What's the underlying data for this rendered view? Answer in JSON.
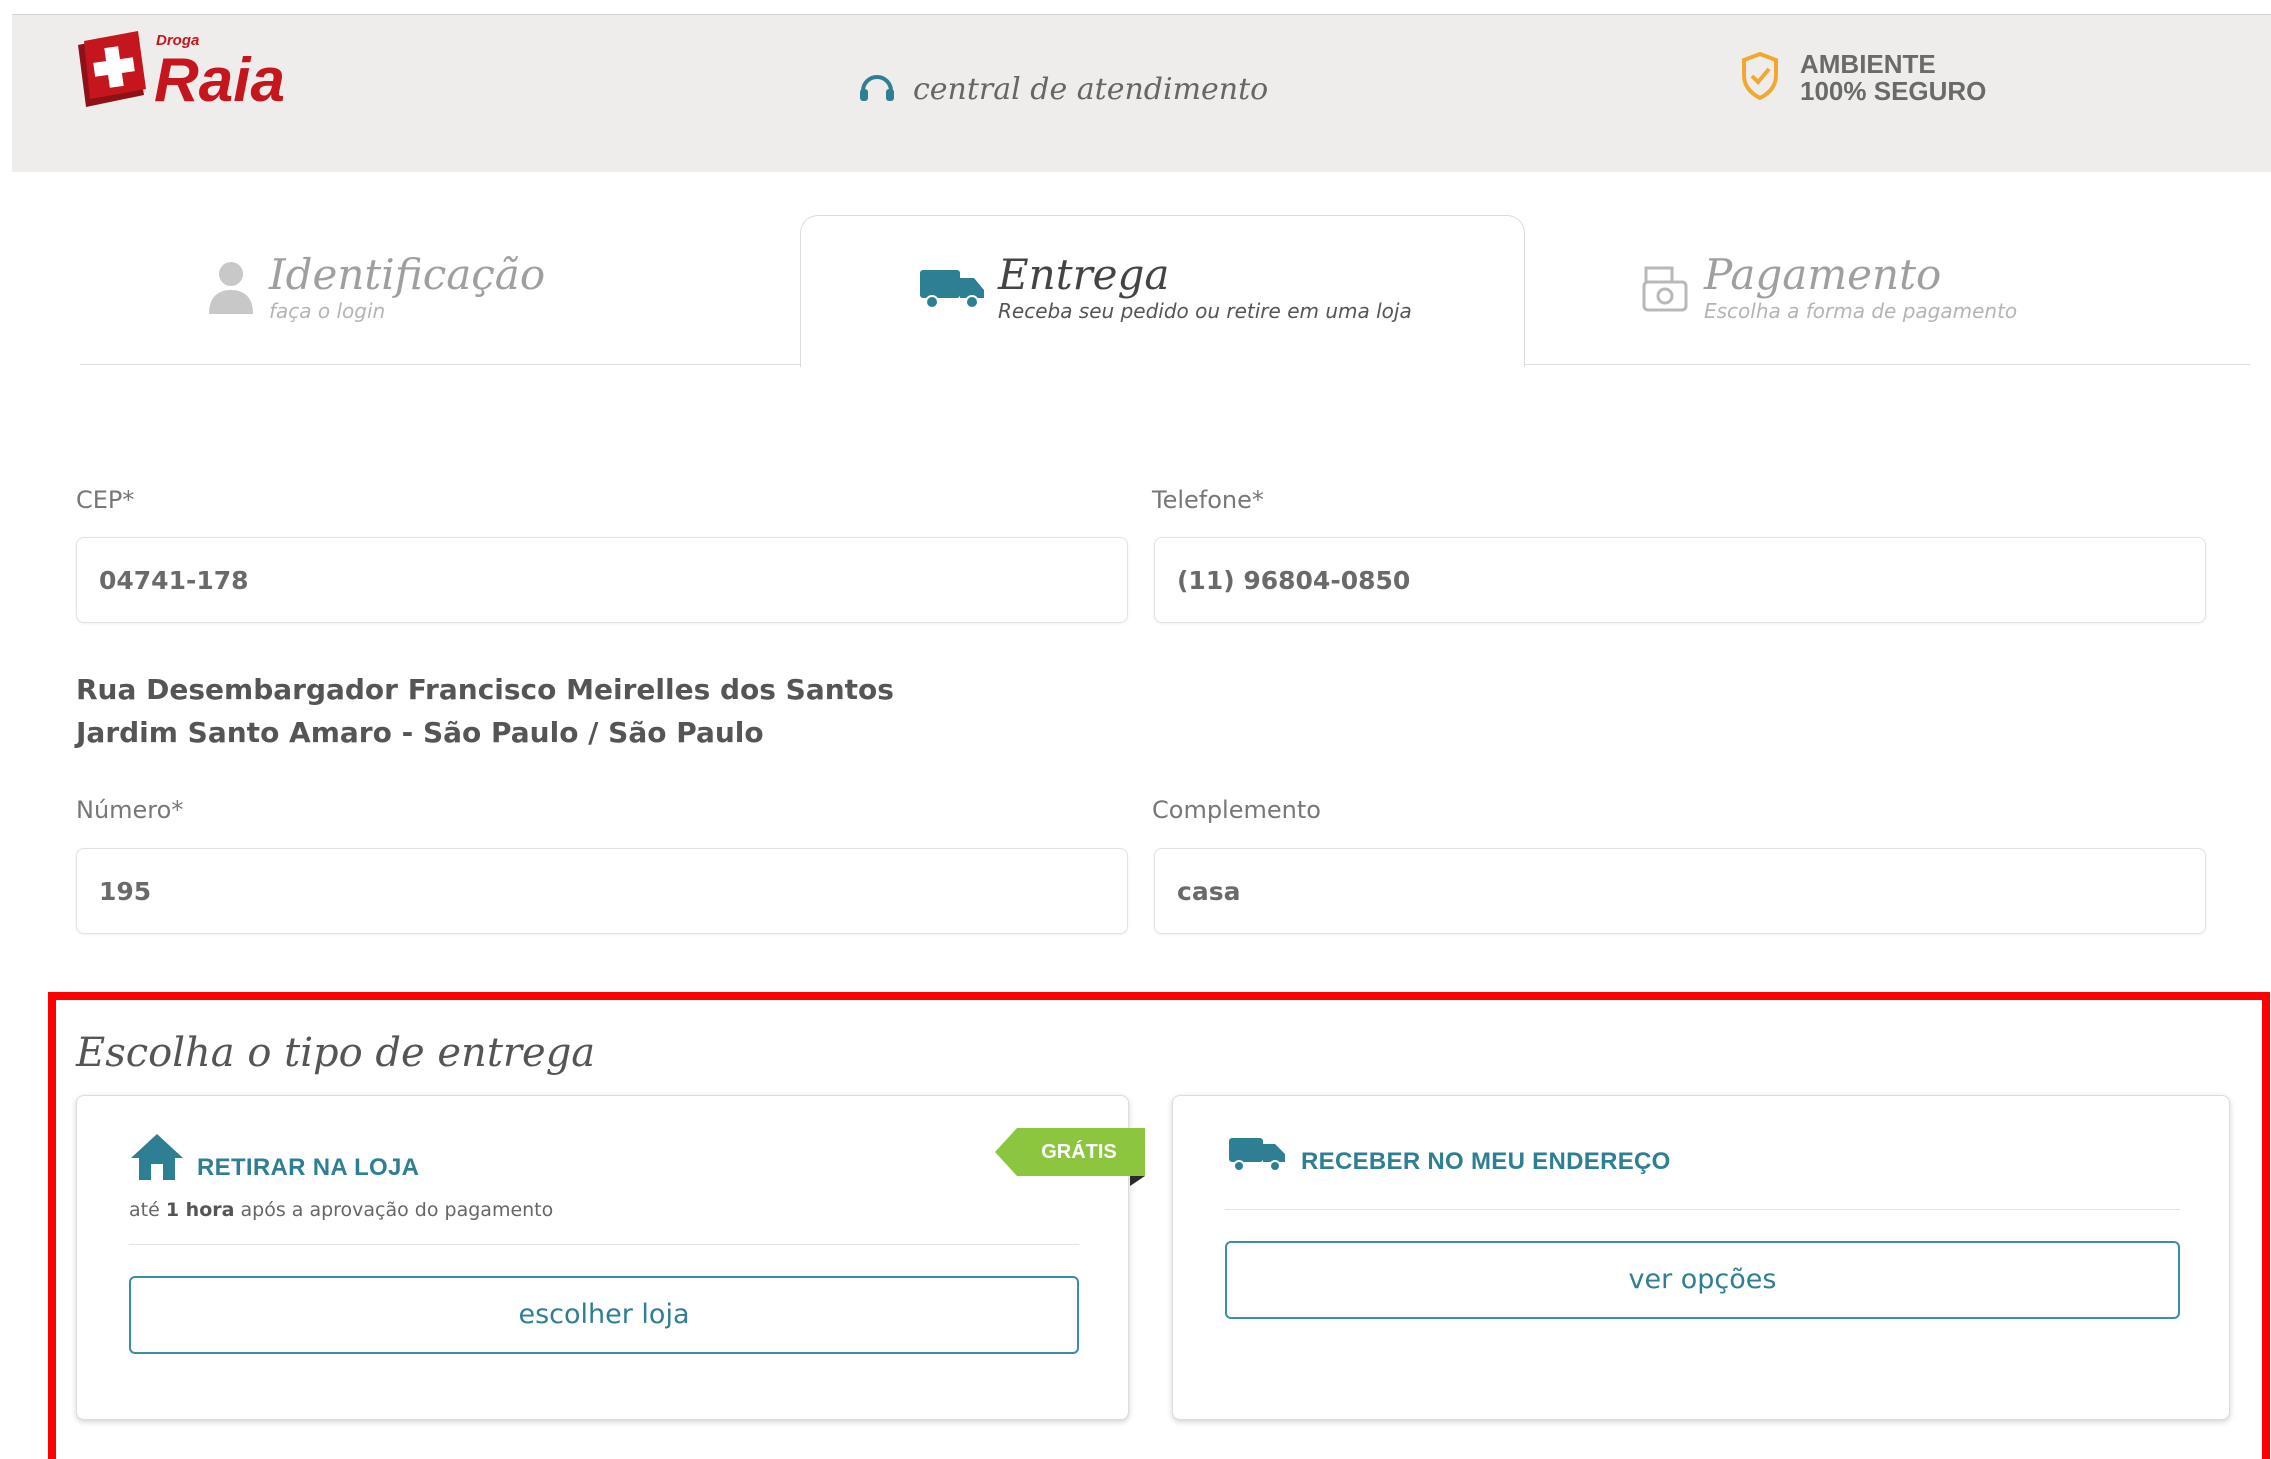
{
  "header": {
    "logo_small": "Droga",
    "logo_big": "Raia",
    "support_text": "central de atendimento",
    "secure_line1": "AMBIENTE",
    "secure_line2": "100% SEGURO"
  },
  "steps": [
    {
      "title": "Identificação",
      "subtitle": "faça o login",
      "state": "inactive"
    },
    {
      "title": "Entrega",
      "subtitle": "Receba seu pedido ou retire em uma loja",
      "state": "active"
    },
    {
      "title": "Pagamento",
      "subtitle": "Escolha a forma de pagamento",
      "state": "inactive"
    }
  ],
  "form": {
    "cep_label": "CEP*",
    "cep_value": "04741-178",
    "phone_label": "Telefone*",
    "phone_value": "(11) 96804-0850",
    "address_line1": "Rua Desembargador Francisco Meirelles dos Santos",
    "address_line2": "Jardim Santo Amaro - São Paulo / São Paulo",
    "number_label": "Número*",
    "number_value": "195",
    "complement_label": "Complemento",
    "complement_value": "casa"
  },
  "delivery": {
    "title": "Escolha o tipo de entrega",
    "pickup": {
      "title": "RETIRAR NA LOJA",
      "sub_prefix": "até",
      "sub_bold": "1 hora",
      "sub_suffix": "após a aprovação do pagamento",
      "badge": "GRÁTIS",
      "button": "escolher loja"
    },
    "home": {
      "title": "RECEBER NO MEU ENDEREÇO",
      "button": "ver opções"
    }
  },
  "colors": {
    "brand_red": "#c4161c",
    "teal": "#2f7f94",
    "badge_green": "#8cc63f",
    "highlight_red": "#ff0000",
    "secure_orange": "#f0a830"
  }
}
